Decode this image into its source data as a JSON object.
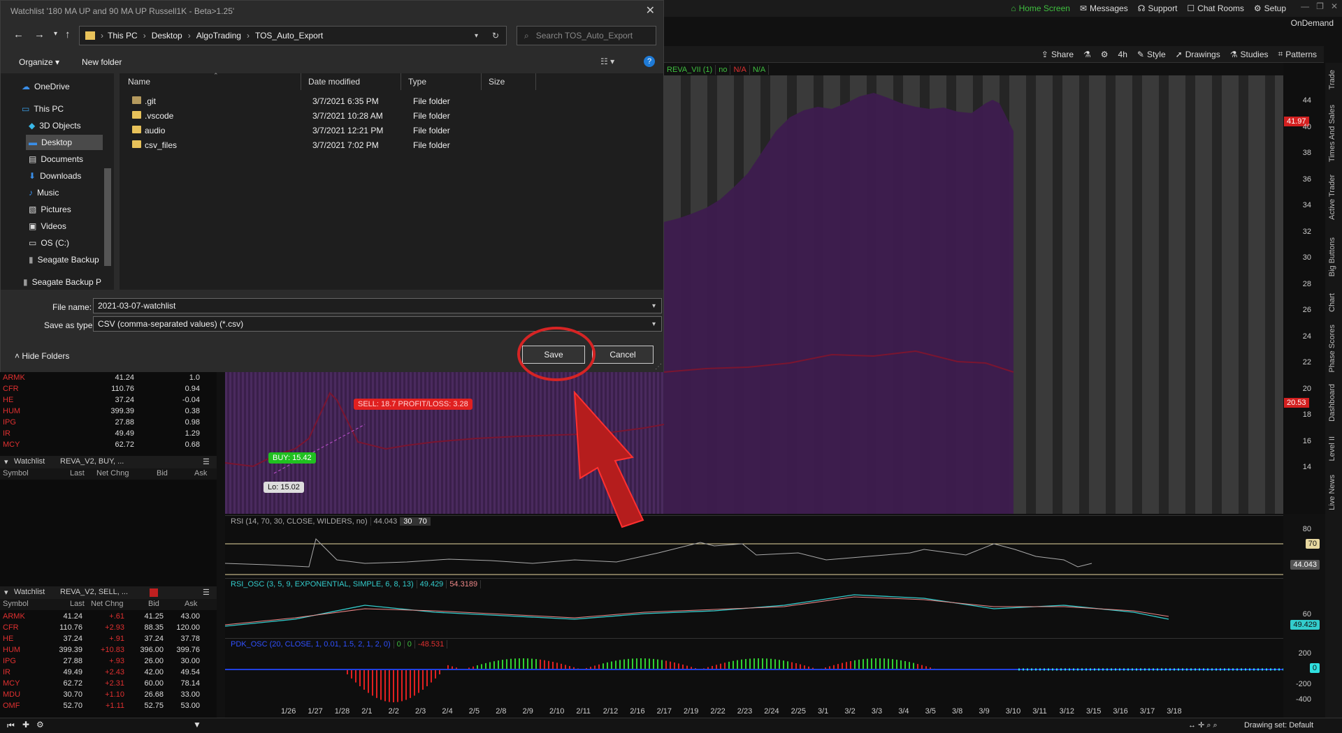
{
  "tos": {
    "topnav": [
      "Home Screen",
      "Messages",
      "Support",
      "Chat Rooms",
      "Setup"
    ],
    "ondemand": "OnDemand",
    "toolbar": [
      "Share",
      "4h",
      "Style",
      "Drawings",
      "Studies",
      "Patterns"
    ],
    "study_header": [
      "REVA_VII (1)",
      "no",
      "N/A",
      "N/A"
    ],
    "price_ticks": [
      "44",
      "40",
      "38",
      "36",
      "34",
      "32",
      "30",
      "28",
      "26",
      "24",
      "22",
      "20",
      "18",
      "16",
      "14"
    ],
    "price_badge_top": "41.97",
    "price_badge_mid": "20.53",
    "chart_labels": {
      "sell": "SELL: 18.7 PROFIT/LOSS: 3.28",
      "buy": "BUY: 15.42",
      "lo": "Lo: 15.02"
    },
    "rsi": {
      "label": [
        "RSI (14, 70, 30, CLOSE, WILDERS, no)",
        "44.043",
        "30",
        "70"
      ],
      "axis": [
        "80",
        "70",
        "44.043"
      ]
    },
    "rsi_osc": {
      "label": [
        "RSI_OSC (3, 5, 9, EXPONENTIAL, SIMPLE, 6, 8, 13)",
        "49.429",
        "54.3189"
      ],
      "axis": [
        "60",
        "49.429"
      ]
    },
    "pdk": {
      "label": [
        "PDK_OSC (20, CLOSE, 1, 0.01, 1.5, 2, 1, 2, 0)",
        "0",
        "0",
        "-48.531"
      ],
      "axis": [
        "200",
        "0",
        "-200",
        "-400"
      ]
    },
    "dates": [
      "1/26",
      "1/27",
      "1/28",
      "2/1",
      "2/2",
      "2/3",
      "2/4",
      "2/5",
      "2/8",
      "2/9",
      "2/10",
      "2/11",
      "2/12",
      "2/16",
      "2/17",
      "2/19",
      "2/22",
      "2/23",
      "2/24",
      "2/25",
      "3/1",
      "3/2",
      "3/3",
      "3/4",
      "3/5",
      "3/8",
      "3/9",
      "3/10",
      "3/11",
      "3/12",
      "3/15",
      "3/16",
      "3/17",
      "3/18"
    ],
    "drawing_set": "Drawing set: Default",
    "right_tabs": [
      "Trade",
      "Times And Sales",
      "Active Trader",
      "Big Buttons",
      "Chart",
      "Phase Scores",
      "Dashboard",
      "Level II",
      "Live News"
    ]
  },
  "watchlist_top_rows": [
    {
      "sym": "ARMK",
      "last": "41.24",
      "chg": "1.0"
    },
    {
      "sym": "CFR",
      "last": "110.76",
      "chg": "0.94"
    },
    {
      "sym": "HE",
      "last": "37.24",
      "chg": "-0.04"
    },
    {
      "sym": "HUM",
      "last": "399.39",
      "chg": "0.38"
    },
    {
      "sym": "IPG",
      "last": "27.88",
      "chg": "0.98"
    },
    {
      "sym": "IR",
      "last": "49.49",
      "chg": "1.29"
    },
    {
      "sym": "MCY",
      "last": "62.72",
      "chg": "0.68"
    }
  ],
  "watchlist_buy": {
    "title": "Watchlist",
    "name": "REVA_V2, BUY, ...",
    "cols": [
      "Symbol",
      "Last",
      "Net Chng",
      "Bid",
      "Ask"
    ]
  },
  "watchlist_sell": {
    "title": "Watchlist",
    "name": "REVA_V2, SELL, ...",
    "cols": [
      "Symbol",
      "Last",
      "Net Chng",
      "Bid",
      "Ask"
    ],
    "rows": [
      {
        "sym": "ARMK",
        "last": "41.24",
        "chg": "+.61",
        "bid": "41.25",
        "ask": "43.00"
      },
      {
        "sym": "CFR",
        "last": "110.76",
        "chg": "+2.93",
        "bid": "88.35",
        "ask": "120.00"
      },
      {
        "sym": "HE",
        "last": "37.24",
        "chg": "+.91",
        "bid": "37.24",
        "ask": "37.78"
      },
      {
        "sym": "HUM",
        "last": "399.39",
        "chg": "+10.83",
        "bid": "396.00",
        "ask": "399.76"
      },
      {
        "sym": "IPG",
        "last": "27.88",
        "chg": "+.93",
        "bid": "26.00",
        "ask": "30.00"
      },
      {
        "sym": "IR",
        "last": "49.49",
        "chg": "+2.43",
        "bid": "42.00",
        "ask": "49.54"
      },
      {
        "sym": "MCY",
        "last": "62.72",
        "chg": "+2.31",
        "bid": "60.00",
        "ask": "78.14"
      },
      {
        "sym": "MDU",
        "last": "30.70",
        "chg": "+1.10",
        "bid": "26.68",
        "ask": "33.00"
      },
      {
        "sym": "OMF",
        "last": "52.70",
        "chg": "+1.11",
        "bid": "52.75",
        "ask": "53.00"
      }
    ]
  },
  "dialog": {
    "title": "Watchlist '180 MA UP and 90 MA UP Russell1K - Beta>1.25'",
    "breadcrumb": [
      "This PC",
      "Desktop",
      "AlgoTrading",
      "TOS_Auto_Export"
    ],
    "search_placeholder": "Search TOS_Auto_Export",
    "organize": "Organize",
    "new_folder": "New folder",
    "nav_items": [
      "OneDrive",
      "This PC",
      "3D Objects",
      "Desktop",
      "Documents",
      "Downloads",
      "Music",
      "Pictures",
      "Videos",
      "OS (C:)",
      "Seagate Backup",
      "Seagate Backup P"
    ],
    "columns": [
      "Name",
      "Date modified",
      "Type",
      "Size"
    ],
    "files": [
      {
        "name": ".git",
        "date": "3/7/2021 6:35 PM",
        "type": "File folder"
      },
      {
        "name": ".vscode",
        "date": "3/7/2021 10:28 AM",
        "type": "File folder"
      },
      {
        "name": "audio",
        "date": "3/7/2021 12:21 PM",
        "type": "File folder"
      },
      {
        "name": "csv_files",
        "date": "3/7/2021 7:02 PM",
        "type": "File folder"
      }
    ],
    "file_name_label": "File name:",
    "file_name_value": "2021-03-07-watchlist",
    "save_type_label": "Save as type:",
    "save_type_value": "CSV (comma-separated values) (*.csv)",
    "hide_folders": "Hide Folders",
    "save": "Save",
    "cancel": "Cancel"
  },
  "colors": {
    "accent_green": "#3fbf3f",
    "annotation_red": "#d62424",
    "bar_purple": "#3e1f4f"
  }
}
